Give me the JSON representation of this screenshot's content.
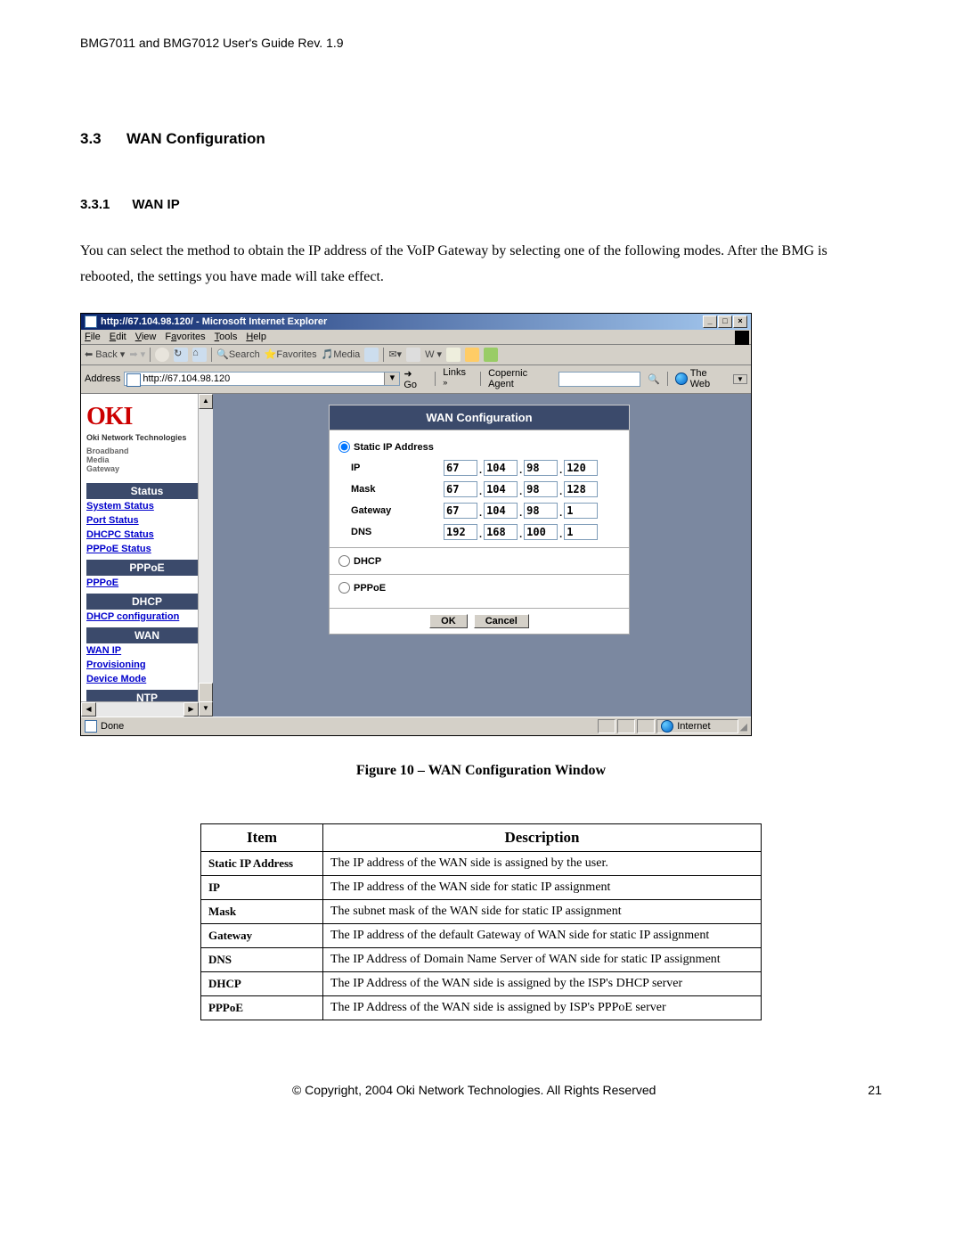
{
  "header": "BMG7011 and BMG7012 User's Guide Rev. 1.9",
  "section": {
    "num": "3.3",
    "title": "WAN Configuration"
  },
  "subsection": {
    "num": "3.3.1",
    "title": "WAN IP"
  },
  "body_para": "You can select the method to obtain the IP address of the VoIP Gateway by selecting one of the following modes. After the BMG is rebooted, the settings you have made will take effect.",
  "figure_caption": "Figure 10 – WAN Configuration Window",
  "footer": {
    "copyright": "©  Copyright, 2004 Oki Network Technologies. All Rights Reserved",
    "page": "21"
  },
  "browser": {
    "title": "http://67.104.98.120/ - Microsoft Internet Explorer",
    "menu": [
      "File",
      "Edit",
      "View",
      "Favorites",
      "Tools",
      "Help"
    ],
    "toolbar": {
      "back": "Back",
      "search": "Search",
      "favorites": "Favorites",
      "media": "Media"
    },
    "address_label": "Address",
    "address_value": "http://67.104.98.120",
    "go": "Go",
    "links": "Links",
    "copernic": "Copernic Agent",
    "the_web": "The Web",
    "status_done": "Done",
    "status_internet": "Internet"
  },
  "sidebar": {
    "logo": "OKI",
    "sub": "Oki Network Technologies",
    "sub2": "Broadband\nMedia\nGateway",
    "groups": [
      {
        "header": "Status",
        "links": [
          "System Status",
          "Port Status",
          "DHCPC Status",
          "PPPoE Status"
        ]
      },
      {
        "header": "PPPoE",
        "links": [
          "PPPoE"
        ]
      },
      {
        "header": "DHCP",
        "links": [
          "DHCP configuration"
        ]
      },
      {
        "header": "WAN",
        "links": [
          "WAN IP",
          "Provisioning",
          "Device Mode"
        ]
      },
      {
        "header": "NTP",
        "links": []
      }
    ]
  },
  "wan": {
    "title": "WAN Configuration",
    "static_label": "Static IP Address",
    "dhcp_label": "DHCP",
    "pppoe_label": "PPPoE",
    "fields": {
      "ip": {
        "label": "IP",
        "vals": [
          "67",
          "104",
          "98",
          "120"
        ]
      },
      "mask": {
        "label": "Mask",
        "vals": [
          "67",
          "104",
          "98",
          "128"
        ]
      },
      "gateway": {
        "label": "Gateway",
        "vals": [
          "67",
          "104",
          "98",
          "1"
        ]
      },
      "dns": {
        "label": "DNS",
        "vals": [
          "192",
          "168",
          "100",
          "1"
        ]
      }
    },
    "ok": "OK",
    "cancel": "Cancel"
  },
  "table": {
    "head": [
      "Item",
      "Description"
    ],
    "rows": [
      [
        "Static IP Address",
        "The IP address of the WAN side is assigned by the user."
      ],
      [
        "IP",
        "The IP address of the WAN side for static IP assignment"
      ],
      [
        "Mask",
        "The subnet mask of the WAN side for static IP assignment"
      ],
      [
        "Gateway",
        "The IP address of the default Gateway of WAN side for static IP assignment"
      ],
      [
        "DNS",
        "The IP Address of Domain Name Server of WAN side for static IP assignment"
      ],
      [
        "DHCP",
        "The IP Address of the WAN side is assigned by the ISP's DHCP server"
      ],
      [
        "PPPoE",
        "The IP Address of the WAN side is assigned by ISP's PPPoE server"
      ]
    ]
  }
}
